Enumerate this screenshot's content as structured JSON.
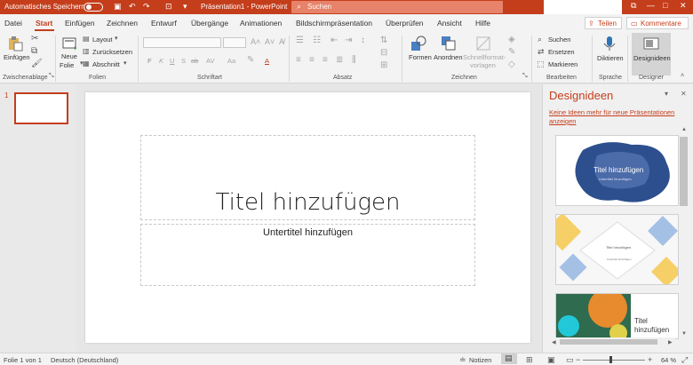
{
  "titlebar": {
    "autosave_label": "Automatisches Speichern",
    "autosave_state": "off",
    "document_title": "Präsentation1 - PowerPoint",
    "search_placeholder": "Suchen",
    "accent_color": "#c43e1c"
  },
  "tabs": [
    {
      "label": "Datei"
    },
    {
      "label": "Start",
      "active": true
    },
    {
      "label": "Einfügen"
    },
    {
      "label": "Zeichnen"
    },
    {
      "label": "Entwurf"
    },
    {
      "label": "Übergänge"
    },
    {
      "label": "Animationen"
    },
    {
      "label": "Bildschirmpräsentation"
    },
    {
      "label": "Überprüfen"
    },
    {
      "label": "Ansicht"
    },
    {
      "label": "Hilfe"
    }
  ],
  "share": {
    "share_label": "Teilen",
    "comments_label": "Kommentare"
  },
  "ribbon": {
    "clipboard": {
      "paste_label": "Einfügen",
      "group_label": "Zwischenablage"
    },
    "slides": {
      "new_slide_line1": "Neue",
      "new_slide_line2": "Folie",
      "layout_label": "Layout",
      "reset_label": "Zurücksetzen",
      "section_label": "Abschnitt",
      "group_label": "Folien"
    },
    "font": {
      "bold": "F",
      "italic": "K",
      "underline": "U",
      "strike": "S",
      "group_label": "Schriftart"
    },
    "paragraph": {
      "group_label": "Absatz"
    },
    "drawing": {
      "shapes_label": "Formen",
      "arrange_label": "Anordnen",
      "quickstyles_line1": "Schnellformat-",
      "quickstyles_line2": "vorlagen",
      "group_label": "Zeichnen"
    },
    "editing": {
      "find_label": "Suchen",
      "replace_label": "Ersetzen",
      "select_label": "Markieren",
      "group_label": "Bearbeiten"
    },
    "voice": {
      "dictate_label": "Diktieren",
      "group_label": "Sprache"
    },
    "designer": {
      "ideas_label": "Designideen",
      "group_label": "Designer"
    }
  },
  "thumbnails": {
    "slide_number": "1"
  },
  "slide": {
    "title_placeholder": "Titel hinzufügen",
    "subtitle_placeholder": "Untertitel hinzufügen"
  },
  "design_pane": {
    "title": "Designideen",
    "link_text": "Keine Ideen mehr für neue Präsentationen anzeigen",
    "cards": [
      {
        "title": "Titel hinzufügen",
        "subtitle": "Untertitel hinzufügen"
      },
      {
        "title": "Titel hinzufügen",
        "subtitle": "Untertitel hinzufügen"
      },
      {
        "title_line1": "Titel",
        "title_line2": "hinzufügen"
      }
    ]
  },
  "statusbar": {
    "slide_info": "Folie 1 von 1",
    "language": "Deutsch (Deutschland)",
    "notes_label": "Notizen",
    "zoom": "64 %"
  }
}
